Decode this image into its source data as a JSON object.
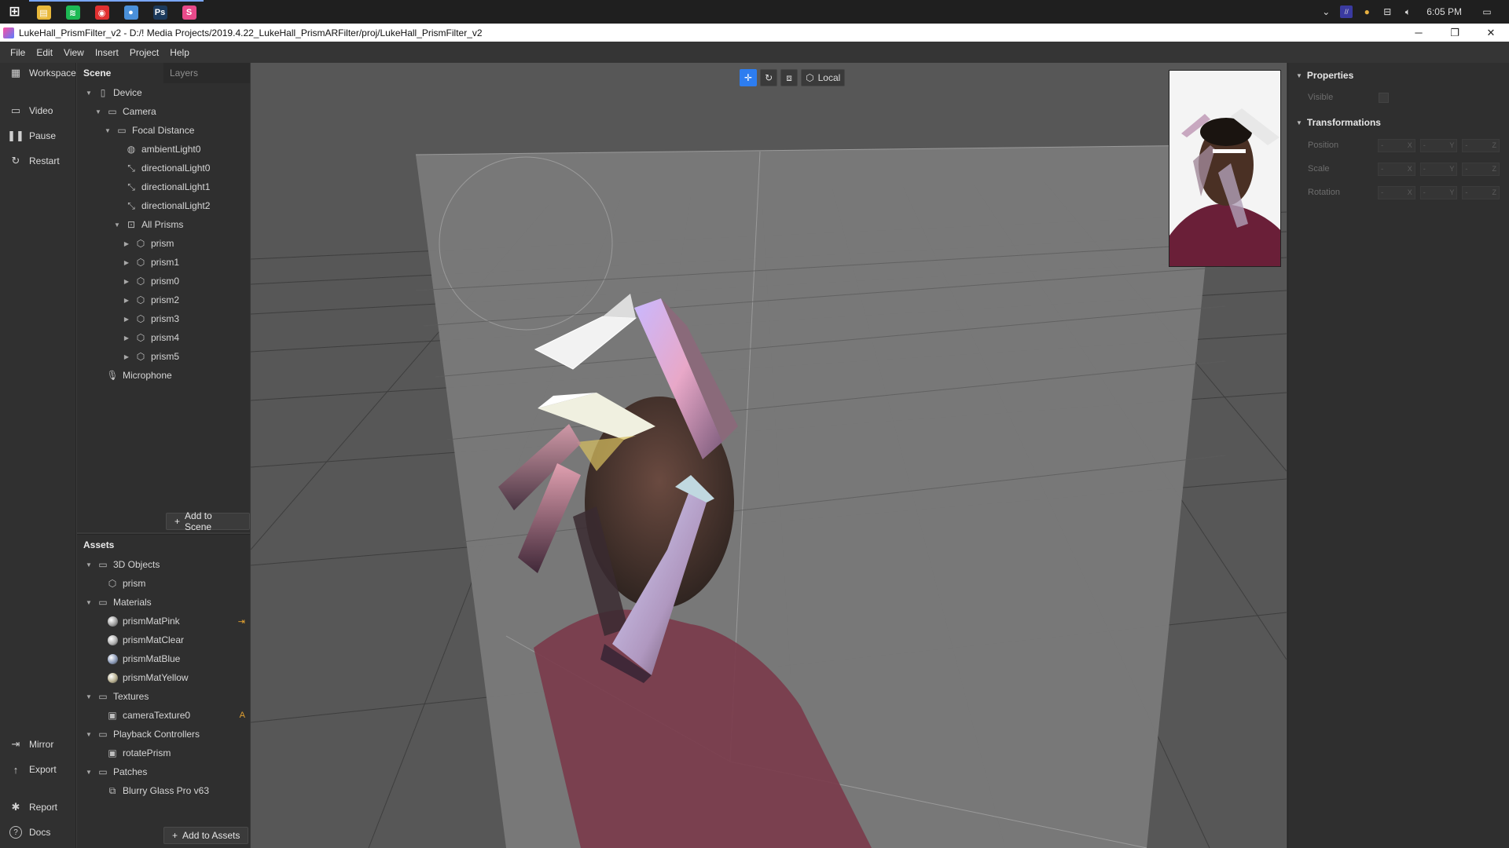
{
  "taskbar": {
    "apps": [
      {
        "name": "windows-start",
        "glyph": "⊞",
        "color": "transparent"
      },
      {
        "name": "file-explorer",
        "glyph": "▤",
        "color": "#e8b83a"
      },
      {
        "name": "spotify",
        "glyph": "≋",
        "color": "#1db954"
      },
      {
        "name": "pocket-casts",
        "glyph": "◉",
        "color": "#e03030"
      },
      {
        "name": "chrome",
        "glyph": "●",
        "color": "#4a90d9"
      },
      {
        "name": "photoshop",
        "glyph": "Ps",
        "color": "#1c3a5c"
      },
      {
        "name": "spark-ar",
        "glyph": "S",
        "color": "#e84a8a"
      }
    ],
    "clock": "6:05 PM"
  },
  "window": {
    "title": "LukeHall_PrismFilter_v2 - D:/! Media Projects/2019.4.22_LukeHall_PrismARFilter/proj/LukeHall_PrismFilter_v2"
  },
  "menu": [
    "File",
    "Edit",
    "View",
    "Insert",
    "Project",
    "Help"
  ],
  "toolstrip": {
    "top": [
      {
        "label": "Workspace",
        "icon": "workspace-icon",
        "glyph": "▦"
      },
      {
        "label": "Video",
        "icon": "video-icon",
        "glyph": "▭"
      },
      {
        "label": "Pause",
        "icon": "pause-icon",
        "glyph": "❚❚"
      },
      {
        "label": "Restart",
        "icon": "restart-icon",
        "glyph": "↻"
      }
    ],
    "bottom": [
      {
        "label": "Mirror",
        "icon": "mirror-icon",
        "glyph": "⇥"
      },
      {
        "label": "Export",
        "icon": "export-icon",
        "glyph": "↑"
      },
      {
        "label": "Report",
        "icon": "bug-icon",
        "glyph": "✱"
      },
      {
        "label": "Docs",
        "icon": "help-icon",
        "glyph": "?"
      }
    ]
  },
  "scene": {
    "tabs": [
      "Scene",
      "Layers"
    ],
    "tree": [
      {
        "label": "Device",
        "depth": 0,
        "arrow": "▼",
        "icon": "device-icon",
        "glyph": "▯"
      },
      {
        "label": "Camera",
        "depth": 1,
        "arrow": "▼",
        "icon": "camera-icon",
        "glyph": "▭"
      },
      {
        "label": "Focal Distance",
        "depth": 2,
        "arrow": "▼",
        "icon": "focal-distance-icon",
        "glyph": "▭"
      },
      {
        "label": "ambientLight0",
        "depth": 3,
        "arrow": "",
        "icon": "ambient-light-icon",
        "glyph": "◍"
      },
      {
        "label": "directionalLight0",
        "depth": 3,
        "arrow": "",
        "icon": "directional-light-icon",
        "glyph": "⤡"
      },
      {
        "label": "directionalLight1",
        "depth": 3,
        "arrow": "",
        "icon": "directional-light-icon",
        "glyph": "⤡"
      },
      {
        "label": "directionalLight2",
        "depth": 3,
        "arrow": "",
        "icon": "directional-light-icon",
        "glyph": "⤡"
      },
      {
        "label": "All Prisms",
        "depth": 3,
        "arrow": "▼",
        "icon": "null-object-icon",
        "glyph": "⊡"
      },
      {
        "label": "prism",
        "depth": 4,
        "arrow": "▶",
        "icon": "3d-object-icon",
        "glyph": "⬡"
      },
      {
        "label": "prism1",
        "depth": 4,
        "arrow": "▶",
        "icon": "3d-object-icon",
        "glyph": "⬡"
      },
      {
        "label": "prism0",
        "depth": 4,
        "arrow": "▶",
        "icon": "3d-object-icon",
        "glyph": "⬡"
      },
      {
        "label": "prism2",
        "depth": 4,
        "arrow": "▶",
        "icon": "3d-object-icon",
        "glyph": "⬡"
      },
      {
        "label": "prism3",
        "depth": 4,
        "arrow": "▶",
        "icon": "3d-object-icon",
        "glyph": "⬡"
      },
      {
        "label": "prism4",
        "depth": 4,
        "arrow": "▶",
        "icon": "3d-object-icon",
        "glyph": "⬡"
      },
      {
        "label": "prism5",
        "depth": 4,
        "arrow": "▶",
        "icon": "3d-object-icon",
        "glyph": "⬡"
      },
      {
        "label": "Microphone",
        "depth": 1,
        "arrow": "",
        "icon": "microphone-icon",
        "glyph": "🎙"
      }
    ],
    "add_button": "Add to Scene"
  },
  "assets": {
    "title": "Assets",
    "tree": [
      {
        "label": "3D Objects",
        "depth": 0,
        "arrow": "▼",
        "icon": "folder-icon",
        "glyph": "▭"
      },
      {
        "label": "prism",
        "depth": 1,
        "arrow": "",
        "icon": "3d-object-icon",
        "glyph": "⬡"
      },
      {
        "label": "Materials",
        "depth": 0,
        "arrow": "▼",
        "icon": "folder-icon",
        "glyph": "▭"
      },
      {
        "label": "prismMatPink",
        "depth": 1,
        "arrow": "",
        "icon": "material-icon",
        "sphere": "#a0a0a0",
        "badge": "⇥"
      },
      {
        "label": "prismMatClear",
        "depth": 1,
        "arrow": "",
        "icon": "material-icon",
        "sphere": "#b0b0b0"
      },
      {
        "label": "prismMatBlue",
        "depth": 1,
        "arrow": "",
        "icon": "material-icon",
        "sphere": "#8a9ab8"
      },
      {
        "label": "prismMatYellow",
        "depth": 1,
        "arrow": "",
        "icon": "material-icon",
        "sphere": "#b8b090"
      },
      {
        "label": "Textures",
        "depth": 0,
        "arrow": "▼",
        "icon": "folder-icon",
        "glyph": "▭"
      },
      {
        "label": "cameraTexture0",
        "depth": 1,
        "arrow": "",
        "icon": "texture-icon",
        "glyph": "▣",
        "badge": "A"
      },
      {
        "label": "Playback Controllers",
        "depth": 0,
        "arrow": "▼",
        "icon": "folder-icon",
        "glyph": "▭"
      },
      {
        "label": "rotatePrism",
        "depth": 1,
        "arrow": "",
        "icon": "animation-icon",
        "glyph": "▣"
      },
      {
        "label": "Patches",
        "depth": 0,
        "arrow": "▼",
        "icon": "folder-icon",
        "glyph": "▭"
      },
      {
        "label": "Blurry Glass Pro v63",
        "depth": 1,
        "arrow": "",
        "icon": "patch-icon",
        "glyph": "⧉"
      }
    ],
    "add_button": "Add to Assets"
  },
  "viewport": {
    "tools": [
      "move-tool",
      "rotate-tool",
      "scale-tool"
    ],
    "space_label": "Local"
  },
  "properties": {
    "section1": "Properties",
    "visible_label": "Visible",
    "section2": "Transformations",
    "rows": [
      {
        "label": "Position",
        "fields": [
          {
            "v": "-",
            "a": "X"
          },
          {
            "v": "-",
            "a": "Y"
          },
          {
            "v": "-",
            "a": "Z"
          }
        ]
      },
      {
        "label": "Scale",
        "fields": [
          {
            "v": "-",
            "a": "X"
          },
          {
            "v": "-",
            "a": "Y"
          },
          {
            "v": "-",
            "a": "Z"
          }
        ]
      },
      {
        "label": "Rotation",
        "fields": [
          {
            "v": "-",
            "a": "X"
          },
          {
            "v": "-",
            "a": "Y"
          },
          {
            "v": "-",
            "a": "Z"
          }
        ]
      }
    ]
  }
}
